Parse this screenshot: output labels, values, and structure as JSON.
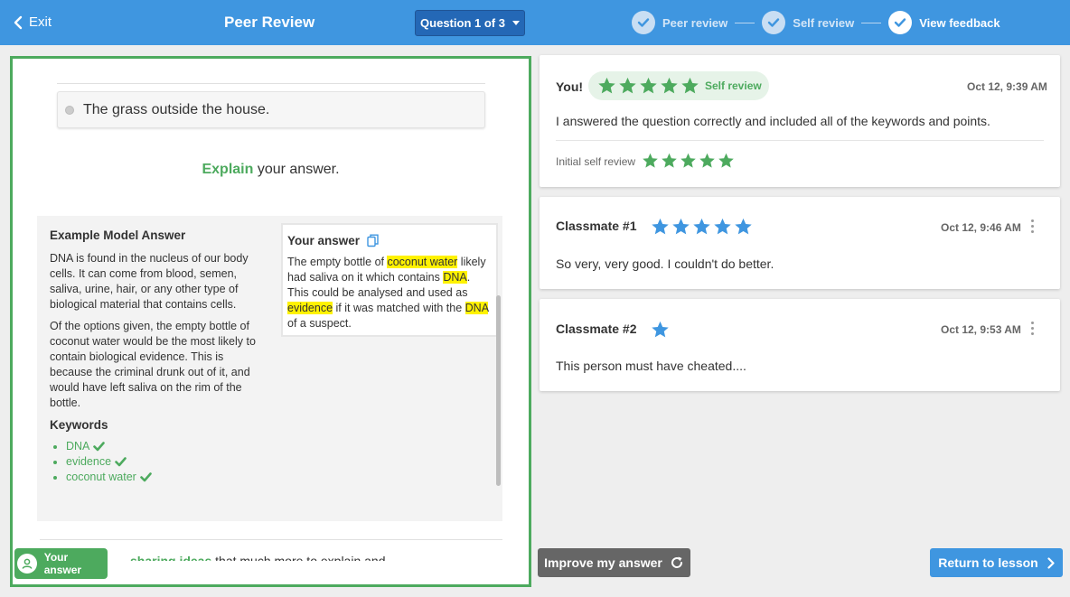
{
  "topbar": {
    "exit_label": "Exit",
    "title": "Peer Review",
    "question_select": "Question 1 of 3",
    "steps": [
      {
        "label": "Peer review",
        "state": "done"
      },
      {
        "label": "Self review",
        "state": "done"
      },
      {
        "label": "View feedback",
        "state": "active"
      }
    ]
  },
  "question": {
    "option_text": "The grass outside the house.",
    "explain_keyword": "Explain",
    "explain_rest": " your answer."
  },
  "model_answer": {
    "heading": "Example Model Answer",
    "para1": "DNA is found in the nucleus of our body cells. It can come from blood, semen, saliva, urine, hair, or any other type of biological material that contains cells.",
    "para2": "Of the options given, the empty bottle of coconut water would be the most likely to contain biological evidence. This is because the criminal drunk out of it, and would have left saliva on the rim of the bottle.",
    "keywords_heading": "Keywords",
    "keywords": [
      "DNA",
      "evidence",
      "coconut water"
    ]
  },
  "your_answer_card": {
    "heading": "Your answer",
    "segments": [
      {
        "text": "The empty bottle of ",
        "hl": false
      },
      {
        "text": "coconut water",
        "hl": true
      },
      {
        "text": " likely had saliva on it which contains ",
        "hl": false
      },
      {
        "text": "DNA",
        "hl": true
      },
      {
        "text": ". This could be analysed and used as ",
        "hl": false
      },
      {
        "text": "evidence",
        "hl": true
      },
      {
        "text": " if it was matched with the ",
        "hl": false
      },
      {
        "text": "DNA",
        "hl": true
      },
      {
        "text": " of a suspect.",
        "hl": false
      }
    ]
  },
  "footer_left": {
    "your_answer_button": "Your answer",
    "cut_text_bold": "sharing ideas",
    "cut_text_rest": " that much more to explain and"
  },
  "reviews": {
    "self": {
      "name": "You!",
      "pill_label": "Self review",
      "rating": 5,
      "date": "Oct 12, 9:39 AM",
      "text": "I answered the question correctly and included all of the keywords and points.",
      "initial_label": "Initial self review",
      "initial_rating": 5
    },
    "classmate1": {
      "name": "Classmate #1",
      "rating": 5,
      "date": "Oct 12, 9:46 AM",
      "text": "So very, very good. I couldn't do better."
    },
    "classmate2": {
      "name": "Classmate #2",
      "rating": 1,
      "date": "Oct 12, 9:53 AM",
      "text": "This person must have cheated...."
    }
  },
  "buttons": {
    "improve": "Improve my answer",
    "return": "Return to lesson"
  },
  "colors": {
    "brand_blue": "#3f96e0",
    "dark_blue": "#2468b6",
    "green": "#4daa5e",
    "highlight": "#fff200",
    "gray_button": "#666666"
  },
  "icons": {
    "exit": "chevron-left-icon",
    "step": "check-circle-icon",
    "copy": "copy-icon",
    "keyword_check": "check-icon",
    "avatar": "user-icon",
    "improve": "refresh-icon",
    "return": "chevron-right-icon",
    "more": "kebab-icon",
    "rating": "star-icon"
  }
}
